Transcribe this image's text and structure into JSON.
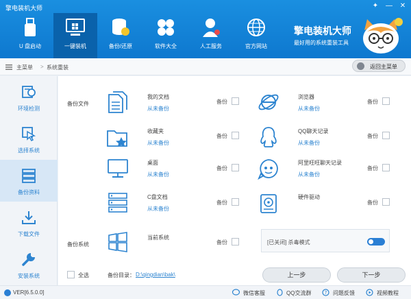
{
  "app": {
    "title": "擎电装机大师",
    "brand_title": "擎电装机大师",
    "brand_subtitle": "最好用的系统重装工具"
  },
  "nav": [
    {
      "label": "U 盘启动",
      "icon": "usb-icon"
    },
    {
      "label": "一键装机",
      "icon": "monitor-icon"
    },
    {
      "label": "备份/还原",
      "icon": "database-icon"
    },
    {
      "label": "软件大全",
      "icon": "apps-icon"
    },
    {
      "label": "人工服务",
      "icon": "support-icon"
    },
    {
      "label": "官方网站",
      "icon": "globe-icon"
    }
  ],
  "breadcrumb": {
    "home": "主菜单",
    "sep": ">",
    "current": "系统重装"
  },
  "back_button": "返回主菜单",
  "sidebar": [
    {
      "label": "环境检测",
      "icon": "env-check-icon"
    },
    {
      "label": "选择系统",
      "icon": "cursor-icon"
    },
    {
      "label": "备份资料",
      "icon": "backup-icon"
    },
    {
      "label": "下载文件",
      "icon": "download-icon"
    },
    {
      "label": "安装系统",
      "icon": "wrench-icon"
    }
  ],
  "main": {
    "backup_files_label": "备份文件",
    "backup_system_label": "备份系统",
    "backup_word": "备份",
    "items": [
      {
        "name": "我的文档",
        "status": "从未备份",
        "icon": "document-icon"
      },
      {
        "name": "浏览器",
        "status": "从未备份",
        "icon": "browser-icon"
      },
      {
        "name": "收藏夹",
        "status": "从未备份",
        "icon": "favorites-folder-icon"
      },
      {
        "name": "QQ聊天记录",
        "status": "从未备份",
        "icon": "qq-icon"
      },
      {
        "name": "桌面",
        "status": "从未备份",
        "icon": "desktop-icon"
      },
      {
        "name": "阿里旺旺聊天记录",
        "status": "从未备份",
        "icon": "wangwang-icon"
      },
      {
        "name": "C盘文档",
        "status": "从未备份",
        "icon": "c-drive-icon"
      },
      {
        "name": "硬件驱动",
        "status": "从未备份",
        "icon": "driver-icon"
      },
      {
        "name": "当前系统",
        "status": "",
        "icon": "windows-icon"
      }
    ],
    "antivirus_text": "[已关闭] 杀毒模式",
    "select_all": "全选",
    "backup_dir_label": "备份目录：",
    "backup_dir_value": "D:\\qingdian\\bak\\",
    "prev_button": "上一步",
    "next_button": "下一步"
  },
  "statusbar": {
    "version": "VER[6.5.0.0]",
    "links": [
      "微信客服",
      "QQ交流群",
      "问题反馈",
      "视频教程"
    ]
  },
  "colors": {
    "primary": "#1a8fe0",
    "accent_text": "#2d84d0",
    "nav_active": "#0a62ab"
  }
}
